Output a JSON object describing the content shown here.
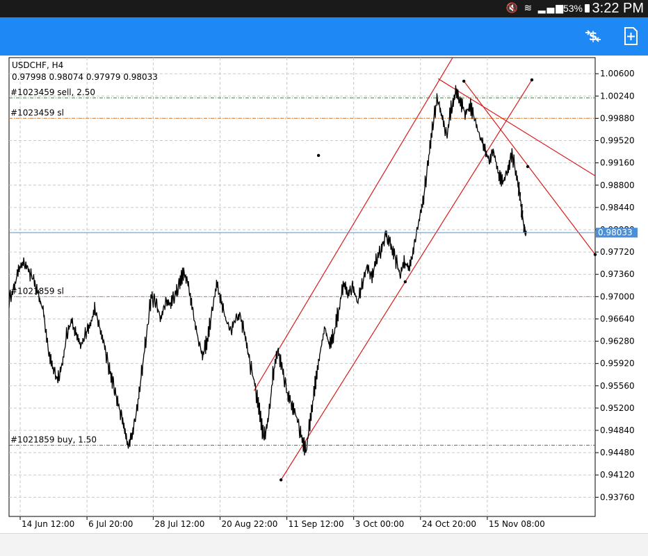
{
  "status_bar": {
    "battery": "53%",
    "time": "3:22 PM",
    "icons": [
      "mute-icon",
      "wifi-icon",
      "signal-icon",
      "battery-icon"
    ]
  },
  "toolbar": {
    "color": "#1e88f5",
    "icons": [
      "order-dollar-icon",
      "new-order-icon"
    ]
  },
  "chart_data": {
    "type": "line",
    "symbol": "USDCHF, H4",
    "ohlc": "0.97998 0.98074 0.97979 0.98033",
    "current_price": 0.98033,
    "current_price_label": "0.98033",
    "ylim": [
      0.9345,
      1.0086
    ],
    "yticks": [
      1.006,
      1.0024,
      0.9988,
      0.9952,
      0.9916,
      0.988,
      0.9844,
      0.9808,
      0.9772,
      0.9736,
      0.97,
      0.9664,
      0.9628,
      0.9592,
      0.9556,
      0.952,
      0.9484,
      0.9448,
      0.9412,
      0.9376
    ],
    "ytick_labels": [
      "1.00600",
      "1.00240",
      "0.99880",
      "0.99520",
      "0.99160",
      "0.98800",
      "0.98440",
      "0.98080",
      "0.97720",
      "0.97360",
      "0.97000",
      "0.96640",
      "0.96280",
      "0.95920",
      "0.95560",
      "0.95200",
      "0.94840",
      "0.94480",
      "0.94120",
      "0.93760"
    ],
    "xlim": [
      0,
      1000
    ],
    "xticks": [
      {
        "x": 19,
        "label": "14 Jun 12:00"
      },
      {
        "x": 133,
        "label": "6 Jul 20:00"
      },
      {
        "x": 246,
        "label": "28 Jul 12:00"
      },
      {
        "x": 360,
        "label": "20 Aug 22:00"
      },
      {
        "x": 474,
        "label": "11 Sep 12:00"
      },
      {
        "x": 588,
        "label": "3 Oct 00:00"
      },
      {
        "x": 702,
        "label": "24 Oct 20:00"
      },
      {
        "x": 816,
        "label": "15 Nov 08:00"
      }
    ],
    "price_path": [
      [
        0,
        0.9695
      ],
      [
        8,
        0.9715
      ],
      [
        16,
        0.9745
      ],
      [
        25,
        0.9755
      ],
      [
        34,
        0.974
      ],
      [
        42,
        0.9725
      ],
      [
        50,
        0.97
      ],
      [
        58,
        0.9675
      ],
      [
        66,
        0.9615
      ],
      [
        74,
        0.9585
      ],
      [
        82,
        0.9565
      ],
      [
        90,
        0.959
      ],
      [
        98,
        0.964
      ],
      [
        106,
        0.966
      ],
      [
        114,
        0.964
      ],
      [
        122,
        0.962
      ],
      [
        130,
        0.964
      ],
      [
        138,
        0.9655
      ],
      [
        146,
        0.968
      ],
      [
        154,
        0.965
      ],
      [
        162,
        0.962
      ],
      [
        170,
        0.9585
      ],
      [
        178,
        0.9555
      ],
      [
        186,
        0.9525
      ],
      [
        194,
        0.9495
      ],
      [
        202,
        0.946
      ],
      [
        210,
        0.948
      ],
      [
        218,
        0.952
      ],
      [
        226,
        0.958
      ],
      [
        234,
        0.964
      ],
      [
        242,
        0.97
      ],
      [
        250,
        0.969
      ],
      [
        258,
        0.9665
      ],
      [
        266,
        0.969
      ],
      [
        274,
        0.969
      ],
      [
        282,
        0.97
      ],
      [
        290,
        0.972
      ],
      [
        298,
        0.974
      ],
      [
        306,
        0.9715
      ],
      [
        314,
        0.967
      ],
      [
        322,
        0.963
      ],
      [
        330,
        0.9605
      ],
      [
        338,
        0.963
      ],
      [
        346,
        0.968
      ],
      [
        354,
        0.972
      ],
      [
        362,
        0.969
      ],
      [
        370,
        0.966
      ],
      [
        378,
        0.9645
      ],
      [
        386,
        0.9665
      ],
      [
        394,
        0.967
      ],
      [
        402,
        0.9635
      ],
      [
        410,
        0.9595
      ],
      [
        418,
        0.956
      ],
      [
        426,
        0.952
      ],
      [
        434,
        0.947
      ],
      [
        442,
        0.9505
      ],
      [
        450,
        0.9575
      ],
      [
        458,
        0.9615
      ],
      [
        466,
        0.958
      ],
      [
        474,
        0.9545
      ],
      [
        482,
        0.9525
      ],
      [
        490,
        0.9505
      ],
      [
        498,
        0.9475
      ],
      [
        506,
        0.945
      ],
      [
        514,
        0.9505
      ],
      [
        522,
        0.956
      ],
      [
        530,
        0.961
      ],
      [
        538,
        0.965
      ],
      [
        546,
        0.962
      ],
      [
        554,
        0.964
      ],
      [
        562,
        0.968
      ],
      [
        570,
        0.972
      ],
      [
        578,
        0.9705
      ],
      [
        586,
        0.9715
      ],
      [
        594,
        0.969
      ],
      [
        602,
        0.972
      ],
      [
        610,
        0.975
      ],
      [
        618,
        0.973
      ],
      [
        626,
        0.976
      ],
      [
        634,
        0.9775
      ],
      [
        642,
        0.98
      ],
      [
        650,
        0.9785
      ],
      [
        658,
        0.9765
      ],
      [
        666,
        0.9735
      ],
      [
        674,
        0.9755
      ],
      [
        682,
        0.9745
      ],
      [
        690,
        0.978
      ],
      [
        698,
        0.982
      ],
      [
        706,
        0.9855
      ],
      [
        714,
        0.9915
      ],
      [
        722,
        0.9975
      ],
      [
        730,
        1.002
      ],
      [
        738,
        0.999
      ],
      [
        746,
        0.996
      ],
      [
        754,
        1.0005
      ],
      [
        762,
        1.003
      ],
      [
        770,
        1.0015
      ],
      [
        778,
        0.9995
      ],
      [
        786,
        1.001
      ],
      [
        794,
        0.9985
      ],
      [
        802,
        0.996
      ],
      [
        810,
        0.994
      ],
      [
        818,
        0.992
      ],
      [
        826,
        0.9935
      ],
      [
        834,
        0.99
      ],
      [
        842,
        0.9885
      ],
      [
        850,
        0.9905
      ],
      [
        858,
        0.993
      ],
      [
        866,
        0.989
      ],
      [
        870,
        0.987
      ],
      [
        874,
        0.984
      ],
      [
        878,
        0.981
      ],
      [
        882,
        0.98
      ]
    ],
    "trendlines": [
      {
        "name": "channel-upper",
        "x": [
          418,
          772
        ],
        "y": [
          0.9548,
          1.011
        ],
        "color": "#d91a1a"
      },
      {
        "name": "channel-lower",
        "x": [
          464,
          892
        ],
        "y": [
          0.9404,
          1.005
        ],
        "color": "#d91a1a"
      },
      {
        "name": "resistance-line-a",
        "x": [
          732,
          1012
        ],
        "y": [
          1.0052,
          0.9888
        ],
        "color": "#d91a1a"
      },
      {
        "name": "resistance-line-b",
        "x": [
          776,
          1000
        ],
        "y": [
          1.0048,
          0.9768
        ],
        "color": "#d91a1a"
      }
    ],
    "anchor_points": [
      {
        "x": 528,
        "y": 0.9928
      },
      {
        "x": 464,
        "y": 0.9404
      },
      {
        "x": 676,
        "y": 0.9724
      },
      {
        "x": 776,
        "y": 1.0048
      },
      {
        "x": 892,
        "y": 1.005
      },
      {
        "x": 885,
        "y": 0.991
      },
      {
        "x": 1000,
        "y": 0.9768
      }
    ],
    "order_lines": [
      {
        "label": "#1023459 sell, 2.50",
        "price": 1.0021,
        "color": "#2a8a2a"
      },
      {
        "label": "#1023459 sl",
        "price": 0.9988,
        "color": "#e07a2a"
      },
      {
        "label": "#1021859 sl",
        "price": 0.97,
        "color": "#e07a2a"
      },
      {
        "label": "#1021859 buy, 1.50",
        "price": 0.946,
        "color": "#2a8a2a"
      }
    ],
    "colors": {
      "price": "#000000",
      "current_line": "#4a90d9",
      "trend": "#d91a1a",
      "grid": "#c8c8c8"
    }
  }
}
